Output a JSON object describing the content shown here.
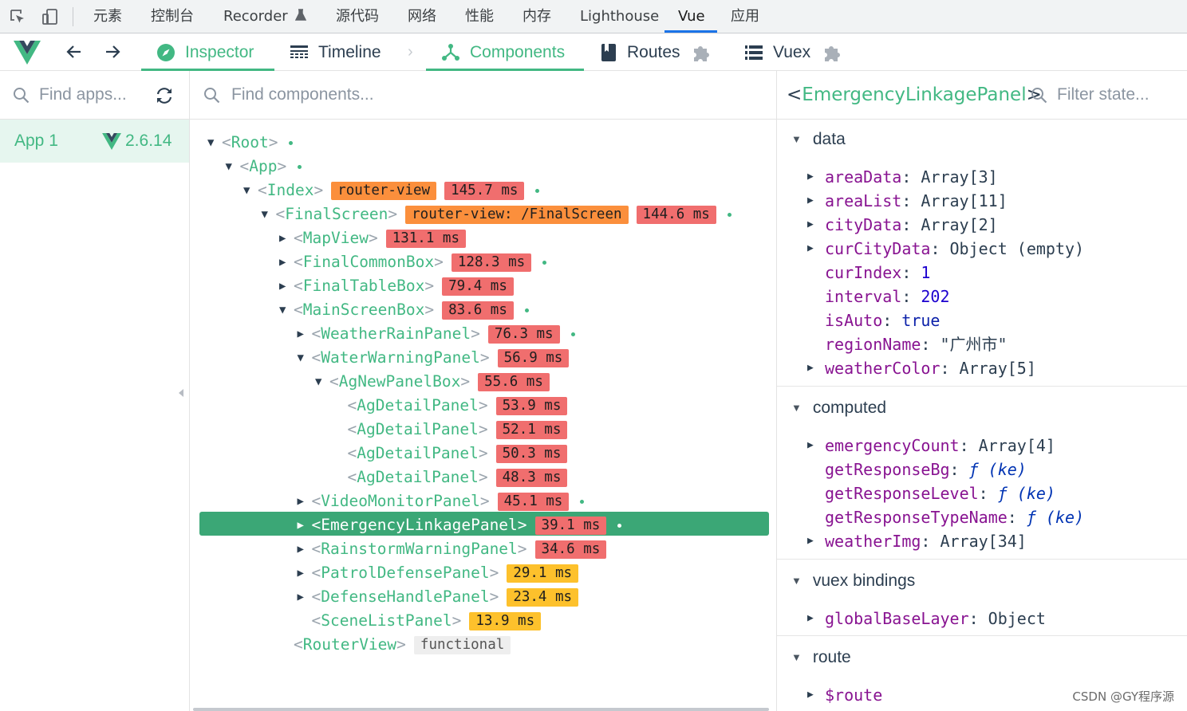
{
  "devtools_tabs": [
    {
      "label": "元素"
    },
    {
      "label": "控制台"
    },
    {
      "label": "Recorder"
    },
    {
      "label": "源代码"
    },
    {
      "label": "网络"
    },
    {
      "label": "性能"
    },
    {
      "label": "内存"
    },
    {
      "label": "Lighthouse"
    },
    {
      "label": "Vue",
      "active": true
    },
    {
      "label": "应用"
    }
  ],
  "vue_toolbar": {
    "inspector": "Inspector",
    "timeline": "Timeline",
    "components": "Components",
    "routes": "Routes",
    "vuex": "Vuex",
    "accent_color": "#42b883"
  },
  "apps": {
    "search_placeholder": "Find apps...",
    "items": [
      {
        "name": "App 1",
        "version": "2.6.14",
        "selected": true
      }
    ]
  },
  "components": {
    "search_placeholder": "Find components...",
    "tree": [
      {
        "name": "Root",
        "caret": "down",
        "badges": [],
        "dot": true
      },
      {
        "name": "App",
        "caret": "down",
        "badges": [],
        "dot": true
      },
      {
        "name": "Index",
        "caret": "down",
        "badges": [
          {
            "text": "router-view",
            "kind": "orange"
          },
          {
            "text": "145.7 ms",
            "kind": "red"
          }
        ],
        "dot": true
      },
      {
        "name": "FinalScreen",
        "caret": "down",
        "badges": [
          {
            "text": "router-view: /FinalScreen",
            "kind": "orange"
          },
          {
            "text": "144.6 ms",
            "kind": "red"
          }
        ],
        "dot": true
      },
      {
        "name": "MapView",
        "caret": "right",
        "badges": [
          {
            "text": "131.1 ms",
            "kind": "red"
          }
        ],
        "dot": false
      },
      {
        "name": "FinalCommonBox",
        "caret": "right",
        "badges": [
          {
            "text": "128.3 ms",
            "kind": "red"
          }
        ],
        "dot": true
      },
      {
        "name": "FinalTableBox",
        "caret": "right",
        "badges": [
          {
            "text": "79.4 ms",
            "kind": "red"
          }
        ],
        "dot": false
      },
      {
        "name": "MainScreenBox",
        "caret": "down",
        "badges": [
          {
            "text": "83.6 ms",
            "kind": "red"
          }
        ],
        "dot": true
      },
      {
        "name": "WeatherRainPanel",
        "caret": "right",
        "badges": [
          {
            "text": "76.3 ms",
            "kind": "red"
          }
        ],
        "dot": true
      },
      {
        "name": "WaterWarningPanel",
        "caret": "down",
        "badges": [
          {
            "text": "56.9 ms",
            "kind": "red"
          }
        ],
        "dot": false
      },
      {
        "name": "AgNewPanelBox",
        "caret": "down",
        "badges": [
          {
            "text": "55.6 ms",
            "kind": "red"
          }
        ],
        "dot": false
      },
      {
        "name": "AgDetailPanel",
        "caret": "none",
        "badges": [
          {
            "text": "53.9 ms",
            "kind": "red"
          }
        ],
        "dot": false
      },
      {
        "name": "AgDetailPanel",
        "caret": "none",
        "badges": [
          {
            "text": "52.1 ms",
            "kind": "red"
          }
        ],
        "dot": false
      },
      {
        "name": "AgDetailPanel",
        "caret": "none",
        "badges": [
          {
            "text": "50.3 ms",
            "kind": "red"
          }
        ],
        "dot": false
      },
      {
        "name": "AgDetailPanel",
        "caret": "none",
        "badges": [
          {
            "text": "48.3 ms",
            "kind": "red"
          }
        ],
        "dot": false
      },
      {
        "name": "VideoMonitorPanel",
        "caret": "right",
        "badges": [
          {
            "text": "45.1 ms",
            "kind": "red"
          }
        ],
        "dot": true
      },
      {
        "name": "EmergencyLinkagePanel",
        "caret": "right",
        "badges": [
          {
            "text": "39.1 ms",
            "kind": "red"
          }
        ],
        "dot": true,
        "selected": true
      },
      {
        "name": "RainstormWarningPanel",
        "caret": "right",
        "badges": [
          {
            "text": "34.6 ms",
            "kind": "red"
          }
        ],
        "dot": false
      },
      {
        "name": "PatrolDefensePanel",
        "caret": "right",
        "badges": [
          {
            "text": "29.1 ms",
            "kind": "yellow"
          }
        ],
        "dot": false
      },
      {
        "name": "DefenseHandlePanel",
        "caret": "right",
        "badges": [
          {
            "text": "23.4 ms",
            "kind": "yellow"
          }
        ],
        "dot": false
      },
      {
        "name": "SceneListPanel",
        "caret": "none",
        "badges": [
          {
            "text": "13.9 ms",
            "kind": "yellow"
          }
        ],
        "dot": false
      },
      {
        "name": "RouterView",
        "caret": "none",
        "badges": [
          {
            "text": "functional",
            "kind": "gray"
          }
        ],
        "dot": false
      }
    ]
  },
  "inspector": {
    "selected_component": "EmergencyLinkagePanel",
    "filter_placeholder": "Filter state...",
    "sections": [
      {
        "title": "data",
        "props": [
          {
            "key": "areaData",
            "value": "Array[3]",
            "expandable": true,
            "type": "plain"
          },
          {
            "key": "areaList",
            "value": "Array[11]",
            "expandable": true,
            "type": "plain"
          },
          {
            "key": "cityData",
            "value": "Array[2]",
            "expandable": true,
            "type": "plain"
          },
          {
            "key": "curCityData",
            "value": "Object (empty)",
            "expandable": true,
            "type": "plain"
          },
          {
            "key": "curIndex",
            "value": "1",
            "expandable": false,
            "type": "num"
          },
          {
            "key": "interval",
            "value": "202",
            "expandable": false,
            "type": "num"
          },
          {
            "key": "isAuto",
            "value": "true",
            "expandable": false,
            "type": "bool"
          },
          {
            "key": "regionName",
            "value": "\"广州市\"",
            "expandable": false,
            "type": "str"
          },
          {
            "key": "weatherColor",
            "value": "Array[5]",
            "expandable": true,
            "type": "plain"
          }
        ]
      },
      {
        "title": "computed",
        "props": [
          {
            "key": "emergencyCount",
            "value": "Array[4]",
            "expandable": true,
            "type": "plain"
          },
          {
            "key": "getResponseBg",
            "value": "ƒ (ke)",
            "expandable": false,
            "type": "fn"
          },
          {
            "key": "getResponseLevel",
            "value": "ƒ (ke)",
            "expandable": false,
            "type": "fn"
          },
          {
            "key": "getResponseTypeName",
            "value": "ƒ (ke)",
            "expandable": false,
            "type": "fn"
          },
          {
            "key": "weatherImg",
            "value": "Array[34]",
            "expandable": true,
            "type": "plain"
          }
        ]
      },
      {
        "title": "vuex bindings",
        "props": [
          {
            "key": "globalBaseLayer",
            "value": "Object",
            "expandable": true,
            "type": "plain"
          }
        ]
      },
      {
        "title": "route",
        "props": [
          {
            "key": "$route",
            "value": "",
            "expandable": true,
            "type": "plain"
          }
        ]
      }
    ]
  },
  "watermark": "CSDN @GY程序源"
}
